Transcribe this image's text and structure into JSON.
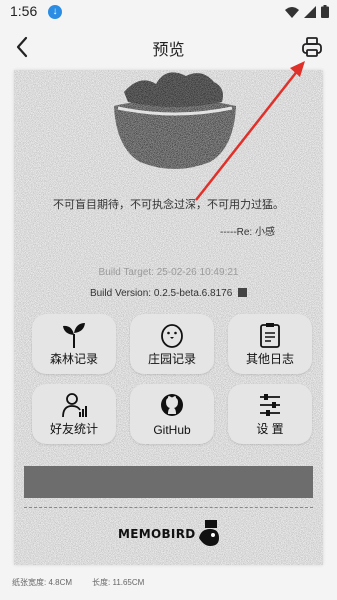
{
  "status": {
    "time": "1:56"
  },
  "appbar": {
    "title": "预览"
  },
  "receipt": {
    "quote": "不可盲目期待，不可执念过深，不可用力过猛。",
    "author": "-----Re: 小感",
    "build_target": "Build Target: 25-02-26 10:49:21",
    "build_version": "Build Version: 0.2.5-beta.6.8176",
    "tiles": [
      {
        "label": "森林记录",
        "icon": "sprout-icon"
      },
      {
        "label": "庄园记录",
        "icon": "chick-icon"
      },
      {
        "label": "其他日志",
        "icon": "clipboard-icon"
      },
      {
        "label": "好友统计",
        "icon": "user-stats-icon"
      },
      {
        "label": "GitHub",
        "icon": "github-icon"
      },
      {
        "label": "设 置",
        "icon": "sliders-icon"
      }
    ],
    "logo_text": "MEMOBIRD"
  },
  "footer": {
    "width": "纸张宽度: 4.8CM",
    "length": "长度: 11.65CM"
  },
  "colors": {
    "accent_arrow": "#e0302a",
    "band": "#6d6d6d",
    "download_badge": "#2a8de3"
  }
}
